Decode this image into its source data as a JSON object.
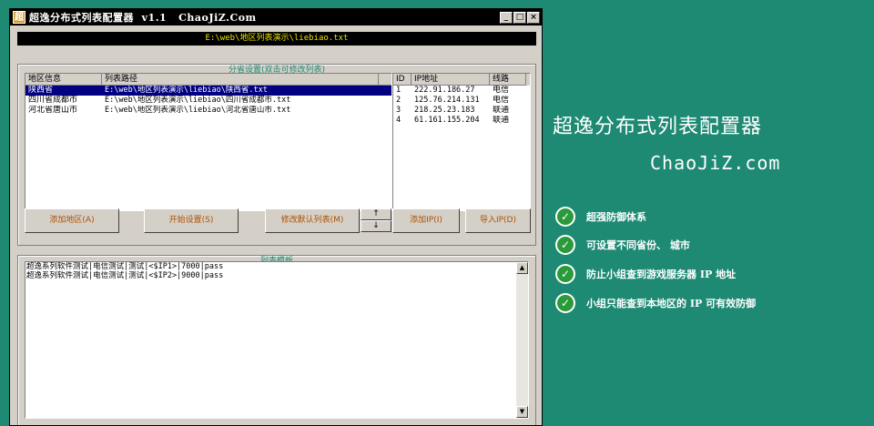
{
  "window": {
    "icon_char": "超",
    "title": "超逸分布式列表配置器  v1.1   ChaoJiZ.Com",
    "minimize": "_",
    "maximize": "□",
    "close": "×"
  },
  "path_bar": "E:\\web\\地区列表演示\\liebiao.txt",
  "province_group": {
    "legend": "分省设置(双击可修改列表)",
    "region_list": {
      "columns": [
        "地区信息",
        "列表路径"
      ],
      "rows": [
        {
          "region": "陕西省",
          "path": "E:\\web\\地区列表演示\\liebiao\\陕西省.txt",
          "selected": true
        },
        {
          "region": "四川省成都市",
          "path": "E:\\web\\地区列表演示\\liebiao\\四川省成都市.txt",
          "selected": false
        },
        {
          "region": "河北省唐山市",
          "path": "E:\\web\\地区列表演示\\liebiao\\河北省唐山市.txt",
          "selected": false
        }
      ]
    },
    "ip_list": {
      "columns": [
        "ID",
        "IP地址",
        "线路"
      ],
      "rows": [
        {
          "id": "1",
          "ip": "222.91.186.27",
          "line": "电信"
        },
        {
          "id": "2",
          "ip": "125.76.214.131",
          "line": "电信"
        },
        {
          "id": "3",
          "ip": "218.25.23.183",
          "line": "联通"
        },
        {
          "id": "4",
          "ip": "61.161.155.204",
          "line": "联通"
        }
      ]
    },
    "buttons": {
      "add_region": "添加地区(A)",
      "start_setup": "开始设置(S)",
      "modify_default": "修改默认列表(M)",
      "up": "↑",
      "down": "↓",
      "add_ip": "添加IP(I)",
      "import_ip": "导入IP(D)"
    }
  },
  "template_group": {
    "legend": "列表模板",
    "lines": [
      "超逸系列软件测试|电信测试|测试|<$IP1>|7000|pass",
      "超逸系列软件测试|电信测试|测试|<$IP2>|9000|pass"
    ],
    "scroll_up": "▲",
    "scroll_down": "▼"
  },
  "side": {
    "title": "超逸分布式列表配置器",
    "site": "ChaoJiZ.com",
    "features": [
      "超强防御体系",
      "可设置不同省份、 城市",
      "防止小组查到游戏服务器 IP 地址",
      "小组只能查到本地区的 IP 可有效防御"
    ],
    "check_char": "✓"
  },
  "colors": {
    "background": "#1e8a74",
    "window": "#d4d0c8",
    "path_text": "#e8e000",
    "selection": "#000080",
    "check_green": "#2a9a3a"
  }
}
